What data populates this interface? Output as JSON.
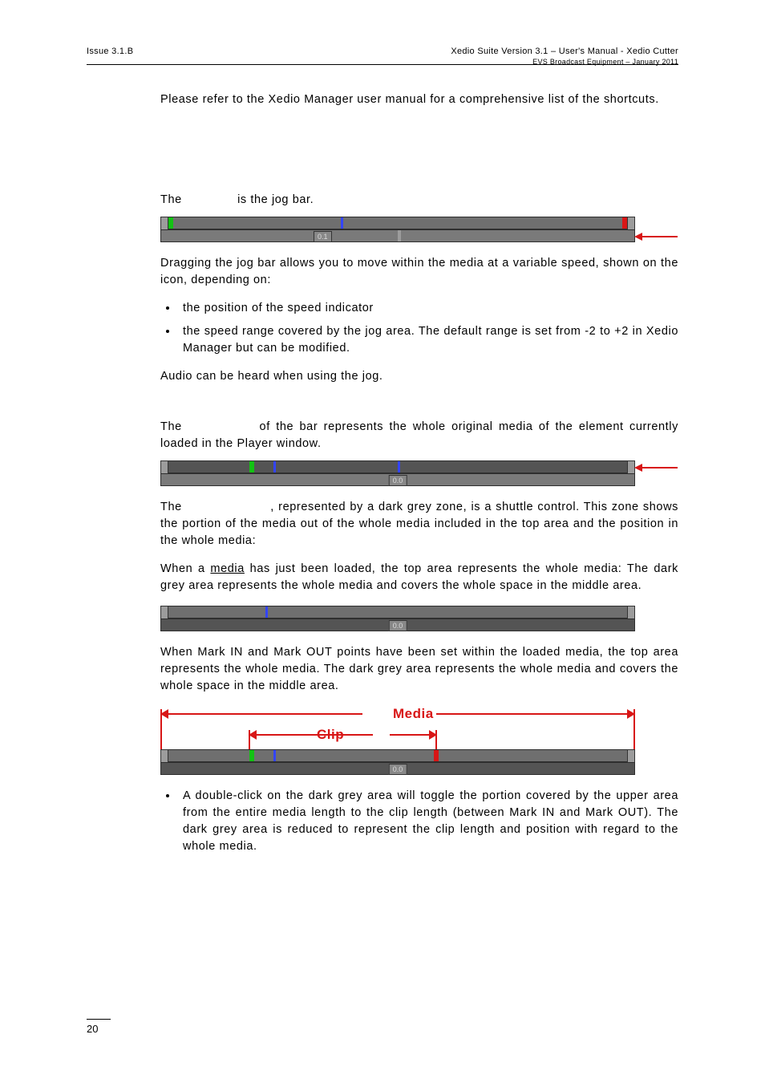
{
  "header": {
    "left": "Issue 3.1.B",
    "right_line1": "Xedio Suite Version 3.1 – User's Manual - Xedio Cutter",
    "right_line2": "EVS Broadcast Equipment – January 2011"
  },
  "intro_para": "Please refer to the Xedio Manager user manual for a comprehensive list of the shortcuts.",
  "jog": {
    "sentence_prefix": "The ",
    "sentence_suffix": " is the jog bar.",
    "speed_value": "0.1",
    "desc": "Dragging the jog bar allows you to move within the media at a variable speed, shown on the icon, depending on:",
    "bullets": [
      "the position of the speed indicator",
      "the speed range covered by the jog area. The default range is set from -2 to +2 in Xedio Manager but can be modified."
    ],
    "audio": "Audio can be heard when using the jog."
  },
  "media_bar": {
    "intro_prefix": "The ",
    "intro_suffix": " of the bar represents the whole original media of the element currently loaded in the Player window.",
    "speed_value": "0.0",
    "shuttle_prefix": "The ",
    "shuttle_suffix": ", represented by a dark grey zone, is a shuttle control. This zone shows the portion of the media out of the whole media included in the top area and the position in the whole media:",
    "when_media_prefix": "When a ",
    "when_media_word": "media",
    "when_media_suffix": " has just been loaded, the top area represents the whole media: The dark grey area represents the whole media and covers the whole space in the middle area.",
    "speed_value2": "0.0",
    "when_marks": "When Mark IN and Mark OUT points have been set within the loaded media, the top area represents the whole media. The dark grey area represents the whole media and covers the whole space in the middle area.",
    "diagram_media_label": "Media",
    "diagram_clip_label": "Clip",
    "speed_value3": "0.0",
    "doubleclick": "A double-click on the dark grey area will toggle the portion covered by the upper area from the entire media length to the clip length (between Mark IN and Mark OUT). The dark grey area is reduced to represent the clip length and position with regard to the whole media."
  },
  "page_number": "20"
}
